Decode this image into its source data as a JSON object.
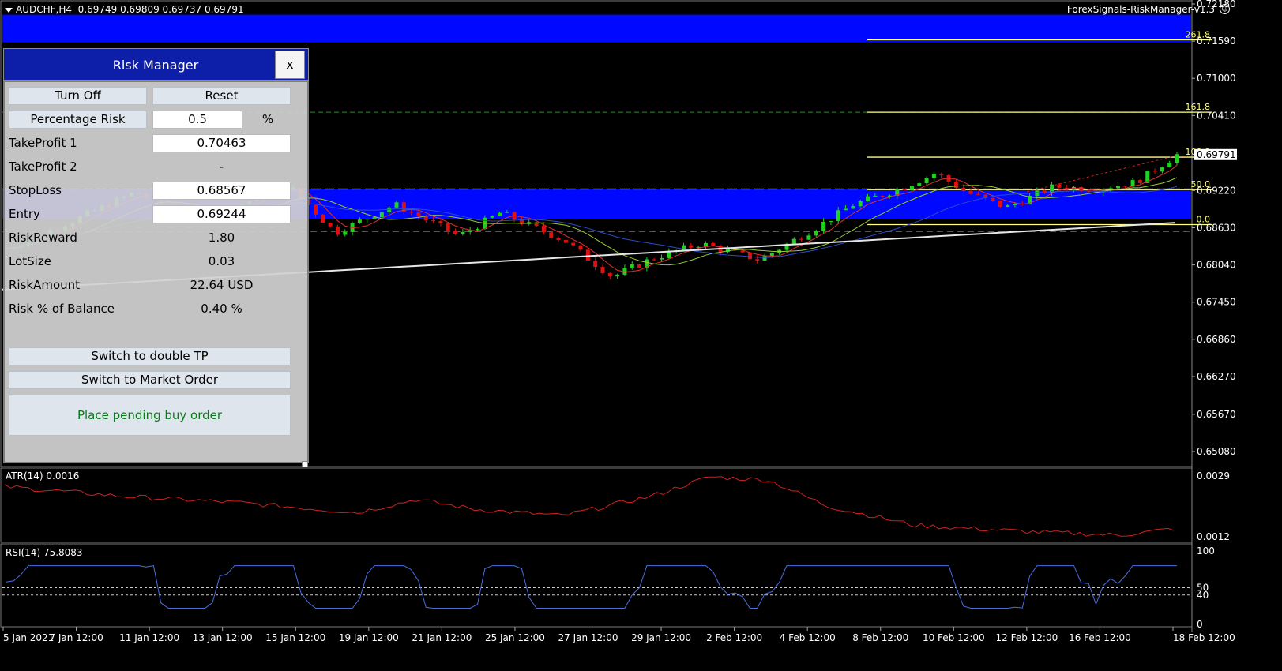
{
  "header": {
    "symbol": "AUDCHF,H4",
    "ohlc": "0.69749 0.69809 0.69737 0.69791",
    "brand": "ForexSignals-RiskManager-v1.3"
  },
  "colors": {
    "band": "#0008ff",
    "bull": "#1fd21f",
    "bear": "#e01010",
    "fib": "#ffff80",
    "ma200": "#e6e6e6",
    "atr": "#d02020",
    "rsi": "#4a6ee0"
  },
  "price_axis": {
    "labels": [
      "0.72180",
      "0.71590",
      "0.71000",
      "0.70410",
      "0.69791",
      "0.69220",
      "0.68630",
      "0.68040",
      "0.67450",
      "0.66860",
      "0.66270",
      "0.65670",
      "0.65080"
    ],
    "current": "0.69791"
  },
  "fib_levels": [
    {
      "label": "261.8",
      "price": 0.7161
    },
    {
      "label": "161.8",
      "price": 0.70463
    },
    {
      "label": "100.0",
      "price": 0.6975
    },
    {
      "label": "50.0",
      "price": 0.69235
    },
    {
      "label": "0.0",
      "price": 0.6868
    }
  ],
  "levels": {
    "band_top": {
      "from": 0.7201,
      "to": 0.7157
    },
    "band_mid": {
      "from": 0.69244,
      "to": 0.6877
    },
    "tp_price": 0.70463,
    "entry_price": 0.69244,
    "stop_price": 0.68567
  },
  "atr": {
    "label": "ATR(14) 0.0016",
    "axis": [
      "0.0029",
      "0.0012"
    ]
  },
  "rsi": {
    "label": "RSI(14) 75.8083",
    "axis": [
      "100",
      "50",
      "40",
      "0"
    ]
  },
  "time_axis": [
    "5 Jan 2021",
    "7 Jan 12:00",
    "11 Jan 12:00",
    "13 Jan 12:00",
    "15 Jan 12:00",
    "19 Jan 12:00",
    "21 Jan 12:00",
    "25 Jan 12:00",
    "27 Jan 12:00",
    "29 Jan 12:00",
    "2 Feb 12:00",
    "4 Feb 12:00",
    "8 Feb 12:00",
    "10 Feb 12:00",
    "12 Feb 12:00",
    "16 Feb 12:00",
    "18 Feb 12:00"
  ],
  "panel": {
    "title": "Risk Manager",
    "close": "x",
    "turn_off": "Turn Off",
    "reset": "Reset",
    "risk_mode": "Percentage Risk",
    "risk_value": "0.5",
    "risk_unit": "%",
    "tp1_label": "TakeProfit 1",
    "tp1_value": "0.70463",
    "tp2_label": "TakeProfit 2",
    "tp2_value": "-",
    "sl_label": "StopLoss",
    "sl_value": "0.68567",
    "entry_label": "Entry",
    "entry_value": "0.69244",
    "rr_label": "RiskReward",
    "rr_value": "1.80",
    "lot_label": "LotSize",
    "lot_value": "0.03",
    "amount_label": "RiskAmount",
    "amount_value": "22.64 USD",
    "pct_label": "Risk % of Balance",
    "pct_value": "0.40 %",
    "double_tp": "Switch to double TP",
    "market_order": "Switch to Market Order",
    "place_order": "Place pending buy order"
  }
}
